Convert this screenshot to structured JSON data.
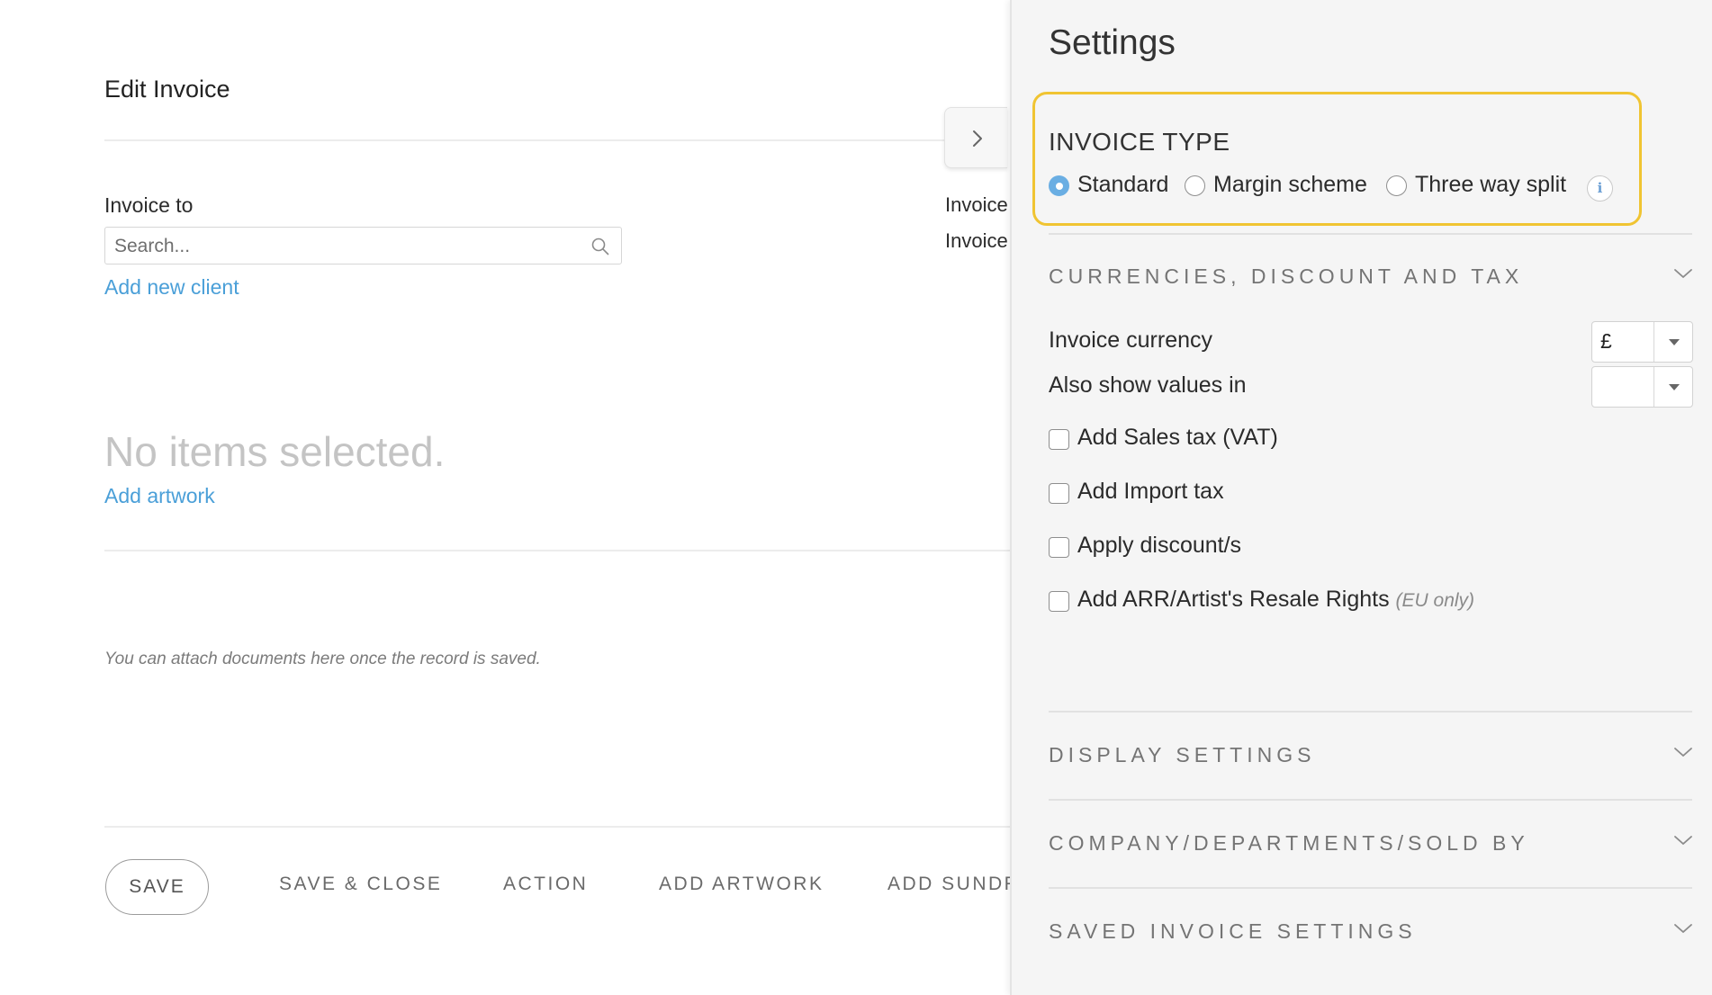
{
  "editor": {
    "title": "Edit Invoice",
    "invoice_to_label": "Invoice to",
    "search_placeholder": "Search...",
    "add_new_client": "Add new client",
    "empty_state": "No items selected.",
    "add_artwork_link": "Add artwork",
    "attach_note": "You can attach documents here once the record is saved.",
    "right_label_1": "Invoice",
    "right_label_2": "Invoice"
  },
  "footer": {
    "save": "SAVE",
    "save_close": "SAVE & CLOSE",
    "action": "ACTION",
    "add_artwork": "ADD ARTWORK",
    "add_sundry": "ADD SUNDR"
  },
  "settings": {
    "title": "Settings",
    "invoice_type": {
      "label": "INVOICE TYPE",
      "options": [
        {
          "label": "Standard",
          "checked": true
        },
        {
          "label": "Margin scheme",
          "checked": false
        },
        {
          "label": "Three way split",
          "checked": false
        }
      ],
      "info_icon": "i"
    },
    "currencies": {
      "heading": "CURRENCIES, DISCOUNT AND TAX",
      "invoice_currency_label": "Invoice currency",
      "invoice_currency_value": "£",
      "also_show_label": "Also show values in",
      "also_show_value": "",
      "checkboxes": [
        {
          "label": "Add Sales tax (VAT)",
          "checked": false
        },
        {
          "label": "Add Import tax",
          "checked": false
        },
        {
          "label": "Apply discount/s",
          "checked": false
        },
        {
          "label": "Add ARR/Artist's Resale Rights",
          "note": "(EU only)",
          "checked": false
        }
      ]
    },
    "sections": [
      {
        "heading": "DISPLAY SETTINGS"
      },
      {
        "heading": "COMPANY/DEPARTMENTS/SOLD BY"
      },
      {
        "heading": "SAVED INVOICE SETTINGS"
      }
    ]
  },
  "colors": {
    "accent_link": "#4a9fd8",
    "highlight_border": "#f0c432",
    "radio_selected": "#6aaee3",
    "panel_background": "#f5f5f5"
  }
}
